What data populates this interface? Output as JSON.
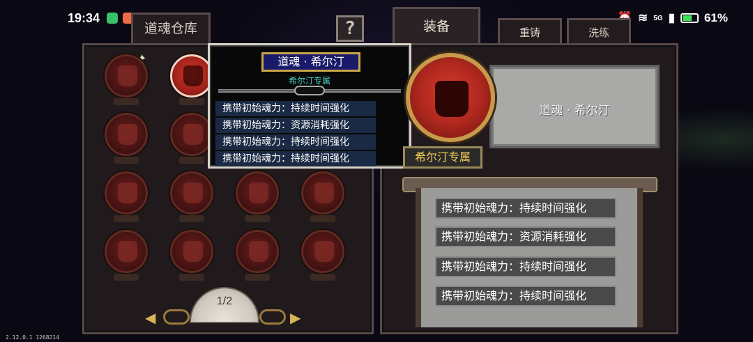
{
  "status_bar": {
    "time": "19:34",
    "battery": "61%",
    "network": "5G"
  },
  "tabs": {
    "warehouse": "道魂仓库",
    "equip": "装备",
    "recast": "重铸",
    "refine": "洗练",
    "help": "?"
  },
  "pager": {
    "label": "1/2"
  },
  "tooltip": {
    "title": "道魂 · 希尔汀",
    "subtitle": "希尔汀专属",
    "attributes": [
      "携带初始魂力：持续时间强化",
      "携带初始魂力：资源消耗强化",
      "携带初始魂力：持续时间强化",
      "携带初始魂力：持续时间强化"
    ]
  },
  "detail": {
    "name": "道魂 · 希尔汀",
    "exclusive": "希尔汀专属",
    "attributes": [
      "携带初始魂力：持续时间强化",
      "携带初始魂力：资源消耗强化",
      "携带初始魂力：持续时间强化",
      "携带初始魂力：持续时间强化"
    ]
  },
  "version": "2.12.0.1 1268214",
  "colors": {
    "panel": "#201a1c",
    "accent_gold": "#c79a4a",
    "soul_red": "#b0281e",
    "exclusive_text": "#f4cc56"
  }
}
